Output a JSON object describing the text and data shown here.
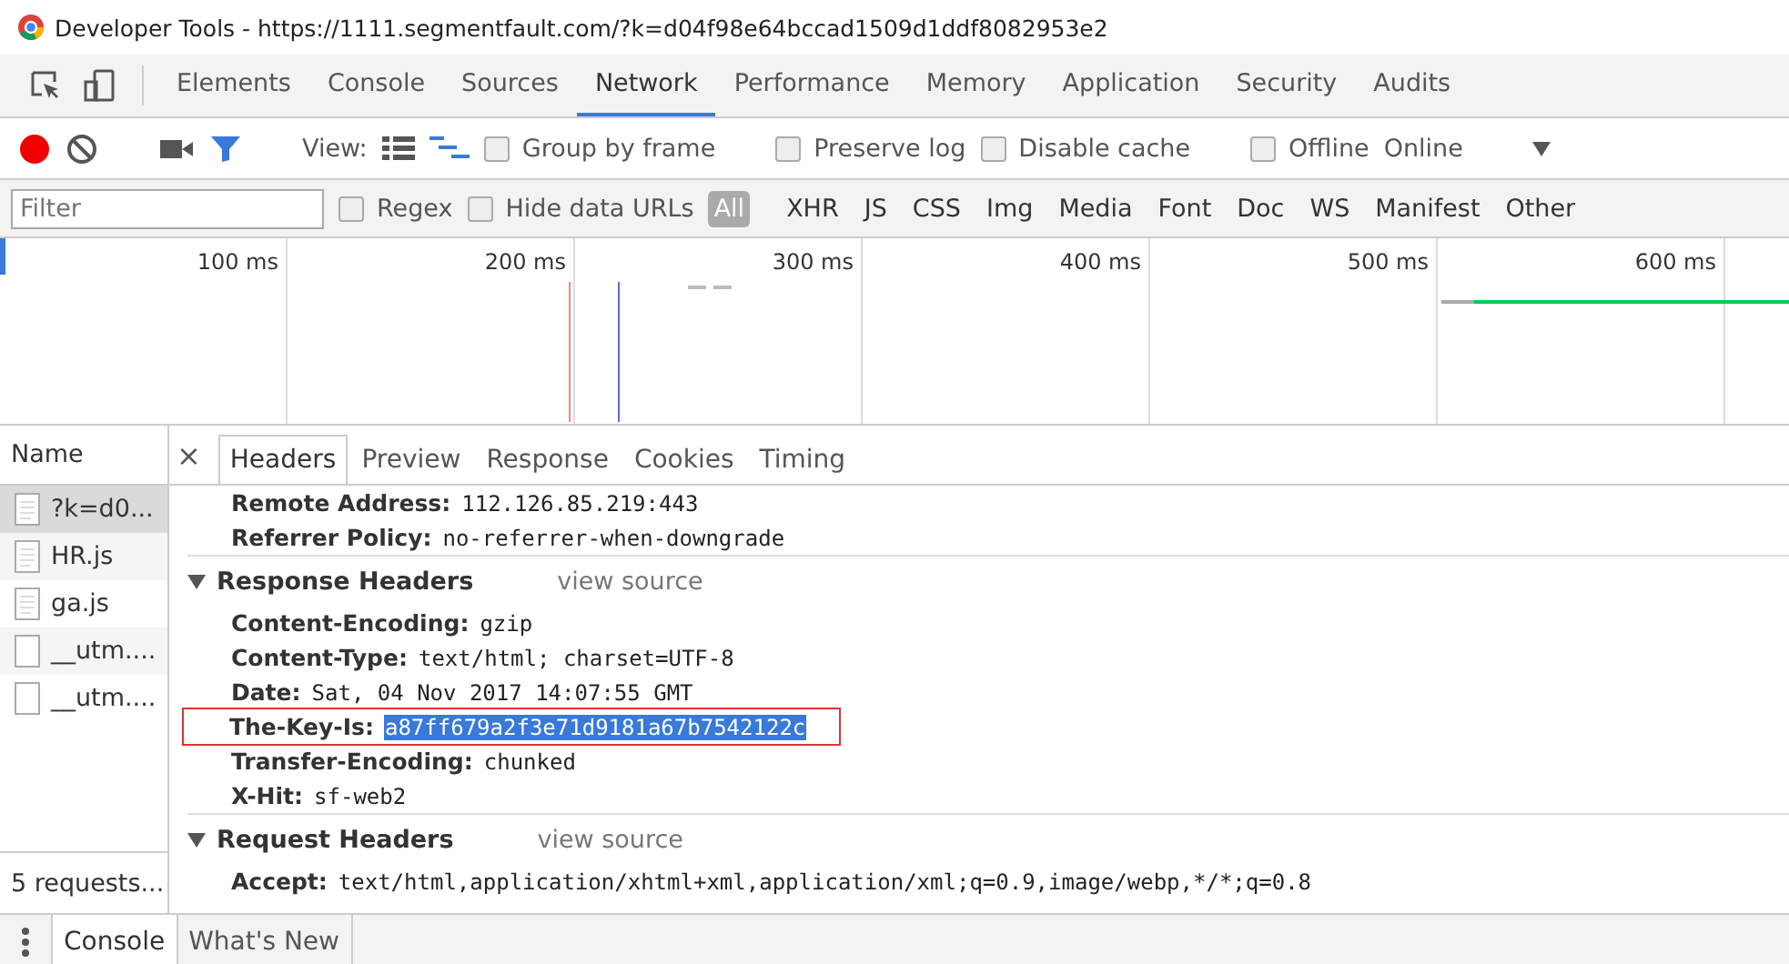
{
  "window": {
    "title": "Developer Tools - https://1111.segmentfault.com/?k=d04f98e64bccad1509d1ddf8082953e2"
  },
  "tabs": [
    {
      "label": "Elements",
      "selected": false
    },
    {
      "label": "Console",
      "selected": false
    },
    {
      "label": "Sources",
      "selected": false
    },
    {
      "label": "Network",
      "selected": true
    },
    {
      "label": "Performance",
      "selected": false
    },
    {
      "label": "Memory",
      "selected": false
    },
    {
      "label": "Application",
      "selected": false
    },
    {
      "label": "Security",
      "selected": false
    },
    {
      "label": "Audits",
      "selected": false
    }
  ],
  "toolbar": {
    "recording": true,
    "filter_active": true,
    "view_label": "View:",
    "options": [
      {
        "label": "Group by frame",
        "checked": false
      },
      {
        "label": "Preserve log",
        "checked": false
      },
      {
        "label": "Disable cache",
        "checked": false
      },
      {
        "label": "Offline",
        "checked": false
      }
    ],
    "throttle": "Online"
  },
  "filter_bar": {
    "placeholder": "Filter",
    "options": [
      {
        "label": "Regex",
        "checked": false
      },
      {
        "label": "Hide data URLs",
        "checked": false
      }
    ],
    "types": [
      {
        "label": "All",
        "selected": true
      },
      {
        "label": "XHR",
        "selected": false
      },
      {
        "label": "JS",
        "selected": false
      },
      {
        "label": "CSS",
        "selected": false
      },
      {
        "label": "Img",
        "selected": false
      },
      {
        "label": "Media",
        "selected": false
      },
      {
        "label": "Font",
        "selected": false
      },
      {
        "label": "Doc",
        "selected": false
      },
      {
        "label": "WS",
        "selected": false
      },
      {
        "label": "Manifest",
        "selected": false
      },
      {
        "label": "Other",
        "selected": false
      }
    ]
  },
  "overview": {
    "ticks": [
      "100 ms",
      "200 ms",
      "300 ms",
      "400 ms",
      "500 ms",
      "600 ms"
    ]
  },
  "requests": {
    "header": "Name",
    "items": [
      {
        "name": "?k=d0...",
        "kind": "document",
        "selected": true
      },
      {
        "name": "HR.js",
        "kind": "document",
        "selected": false
      },
      {
        "name": "ga.js",
        "kind": "document",
        "selected": false
      },
      {
        "name": "__utm....",
        "kind": "blank",
        "selected": false
      },
      {
        "name": "__utm....",
        "kind": "blank",
        "selected": false
      }
    ],
    "summary": "5 requests..."
  },
  "details": {
    "close": "×",
    "tabs": [
      {
        "label": "Headers",
        "selected": true
      },
      {
        "label": "Preview",
        "selected": false
      },
      {
        "label": "Response",
        "selected": false
      },
      {
        "label": "Cookies",
        "selected": false
      },
      {
        "label": "Timing",
        "selected": false
      }
    ],
    "general_rows": [
      {
        "key": "Remote Address:",
        "value": "112.126.85.219:443",
        "highlighted": false
      },
      {
        "key": "Referrer Policy:",
        "value": "no-referrer-when-downgrade",
        "highlighted": false
      }
    ],
    "sections": [
      {
        "title": "Response Headers",
        "link": "view source",
        "expanded": true,
        "rows": [
          {
            "key": "Content-Encoding:",
            "value": "gzip",
            "highlighted": false
          },
          {
            "key": "Content-Type:",
            "value": "text/html; charset=UTF-8",
            "highlighted": false
          },
          {
            "key": "Date:",
            "value": "Sat, 04 Nov 2017 14:07:55 GMT",
            "highlighted": false
          },
          {
            "key": "The-Key-Is:",
            "value": "a87ff679a2f3e71d9181a67b7542122c",
            "highlighted": true
          },
          {
            "key": "Transfer-Encoding:",
            "value": "chunked",
            "highlighted": false
          },
          {
            "key": "X-Hit:",
            "value": "sf-web2",
            "highlighted": false
          }
        ]
      },
      {
        "title": "Request Headers",
        "link": "view source",
        "expanded": true,
        "rows": [
          {
            "key": "Accept:",
            "value": "text/html,application/xhtml+xml,application/xml;q=0.9,image/webp,*/*;q=0.8",
            "highlighted": false
          }
        ]
      }
    ]
  },
  "drawer": {
    "tabs": [
      {
        "label": "Console",
        "selected": true
      },
      {
        "label": "What's New",
        "selected": false
      }
    ]
  }
}
